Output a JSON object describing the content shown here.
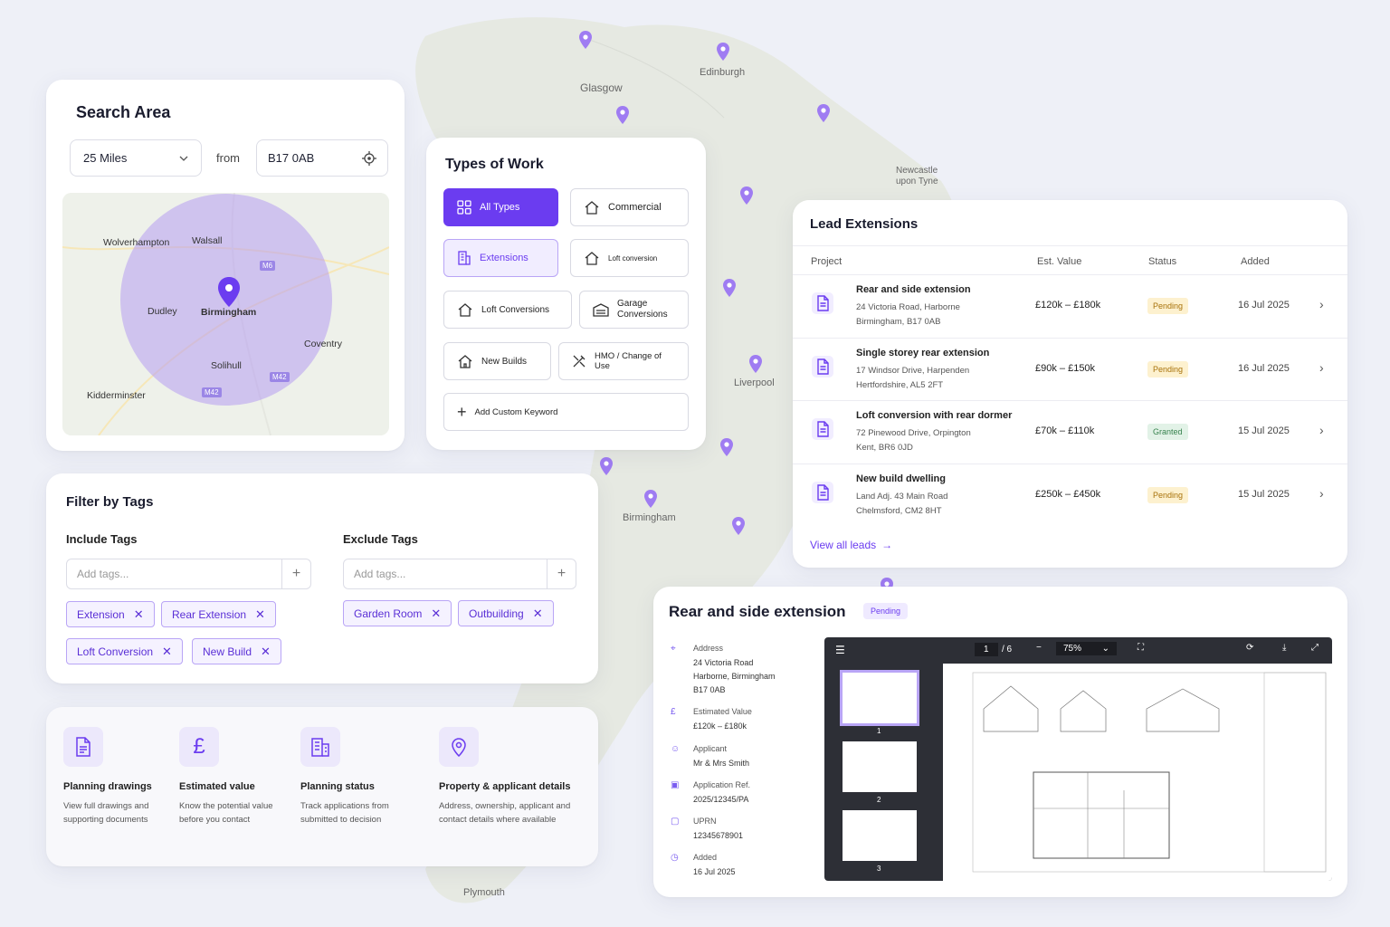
{
  "map": {
    "cities": [
      "Glasgow",
      "Edinburgh",
      "Newcastle\nupon Tyne",
      "Liverpool",
      "Birmingham",
      "Plymouth"
    ]
  },
  "search": {
    "title": "Search Area",
    "radius": "25 Miles",
    "from": "from",
    "postcode": "B17 0AB",
    "map_labels": [
      "Wolverhampton",
      "Walsall",
      "Dudley",
      "Birmingham",
      "Coventry",
      "Solihull",
      "Kidderminster"
    ],
    "roads": [
      "M6",
      "M42",
      "M42"
    ]
  },
  "types": {
    "title": "Types of Work",
    "items": [
      "All Types",
      "Commercial",
      "Extensions",
      "Loft conversion",
      "Loft Conversions",
      "Garage\nConversions",
      "New Builds",
      "HMO / Change of Use",
      "Add Custom Keyword"
    ]
  },
  "tags": {
    "title": "Filter by Tags",
    "include_title": "Include Tags",
    "exclude_title": "Exclude Tags",
    "placeholder": "Add tags...",
    "include": [
      "Extension",
      "Rear Extension",
      "Loft Conversion",
      "New Build"
    ],
    "exclude": [
      "Garden Room",
      "Outbuilding"
    ]
  },
  "features": [
    {
      "title": "Planning drawings",
      "desc": "View full drawings and supporting documents",
      "icon": "document-icon"
    },
    {
      "title": "Estimated value",
      "desc": "Know the potential value before you contact",
      "icon": "pound-icon"
    },
    {
      "title": "Planning status",
      "desc": "Track applications from submitted to decision",
      "icon": "building-icon"
    },
    {
      "title": "Property & applicant details",
      "desc": "Address, ownership, applicant and contact details where available",
      "icon": "location-icon"
    }
  ],
  "leads": {
    "title": "Lead Extensions",
    "headers": [
      "Project",
      "Est. Value",
      "Status",
      "Added"
    ],
    "rows": [
      {
        "title": "Rear and side extension",
        "addr1": "24 Victoria Road, Harborne",
        "addr2": "Birmingham, B17 0AB",
        "value": "£120k – £180k",
        "status": "Pending",
        "added": "16 Jul 2025"
      },
      {
        "title": "Single storey rear extension",
        "addr1": "17 Windsor Drive, Harpenden",
        "addr2": "Hertfordshire, AL5 2FT",
        "value": "£90k – £150k",
        "status": "Pending",
        "added": "16 Jul 2025"
      },
      {
        "title": "Loft conversion with rear dormer",
        "addr1": "72 Pinewood Drive, Orpington",
        "addr2": "Kent, BR6 0JD",
        "value": "£70k – £110k",
        "status": "Granted",
        "added": "15 Jul 2025"
      },
      {
        "title": "New build dwelling",
        "addr1": "Land Adj. 43 Main Road",
        "addr2": "Chelmsford, CM2 8HT",
        "value": "£250k – £450k",
        "status": "Pending",
        "added": "15 Jul 2025"
      }
    ],
    "view_all": "View all leads"
  },
  "detail": {
    "title": "Rear and side extension",
    "status": "Pending",
    "fields": [
      {
        "label": "Address",
        "value": "24 Victoria Road\nHarborne, Birmingham\nB17 0AB"
      },
      {
        "label": "Estimated Value",
        "value": "£120k – £180k"
      },
      {
        "label": "Applicant",
        "value": "Mr & Mrs Smith"
      },
      {
        "label": "Application Ref.",
        "value": "2025/12345/PA"
      },
      {
        "label": "UPRN",
        "value": "12345678901"
      },
      {
        "label": "Added",
        "value": "16 Jul 2025"
      }
    ],
    "viewer": {
      "page": "1",
      "pages": "/ 6",
      "zoom": "75%",
      "thumb_labels": [
        "1",
        "2",
        "3"
      ]
    }
  },
  "colors": {
    "accent": "#6b3cf0",
    "pending": "#fdf1cf",
    "granted": "#e2f2e7"
  }
}
